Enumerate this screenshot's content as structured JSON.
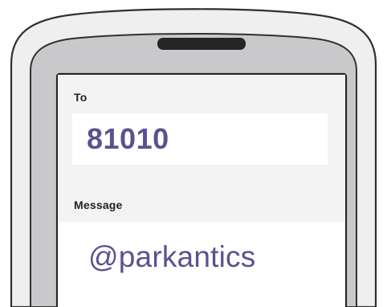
{
  "compose": {
    "to_label": "To",
    "to_value": "81010",
    "message_label": "Message",
    "message_value": "@parkantics"
  }
}
